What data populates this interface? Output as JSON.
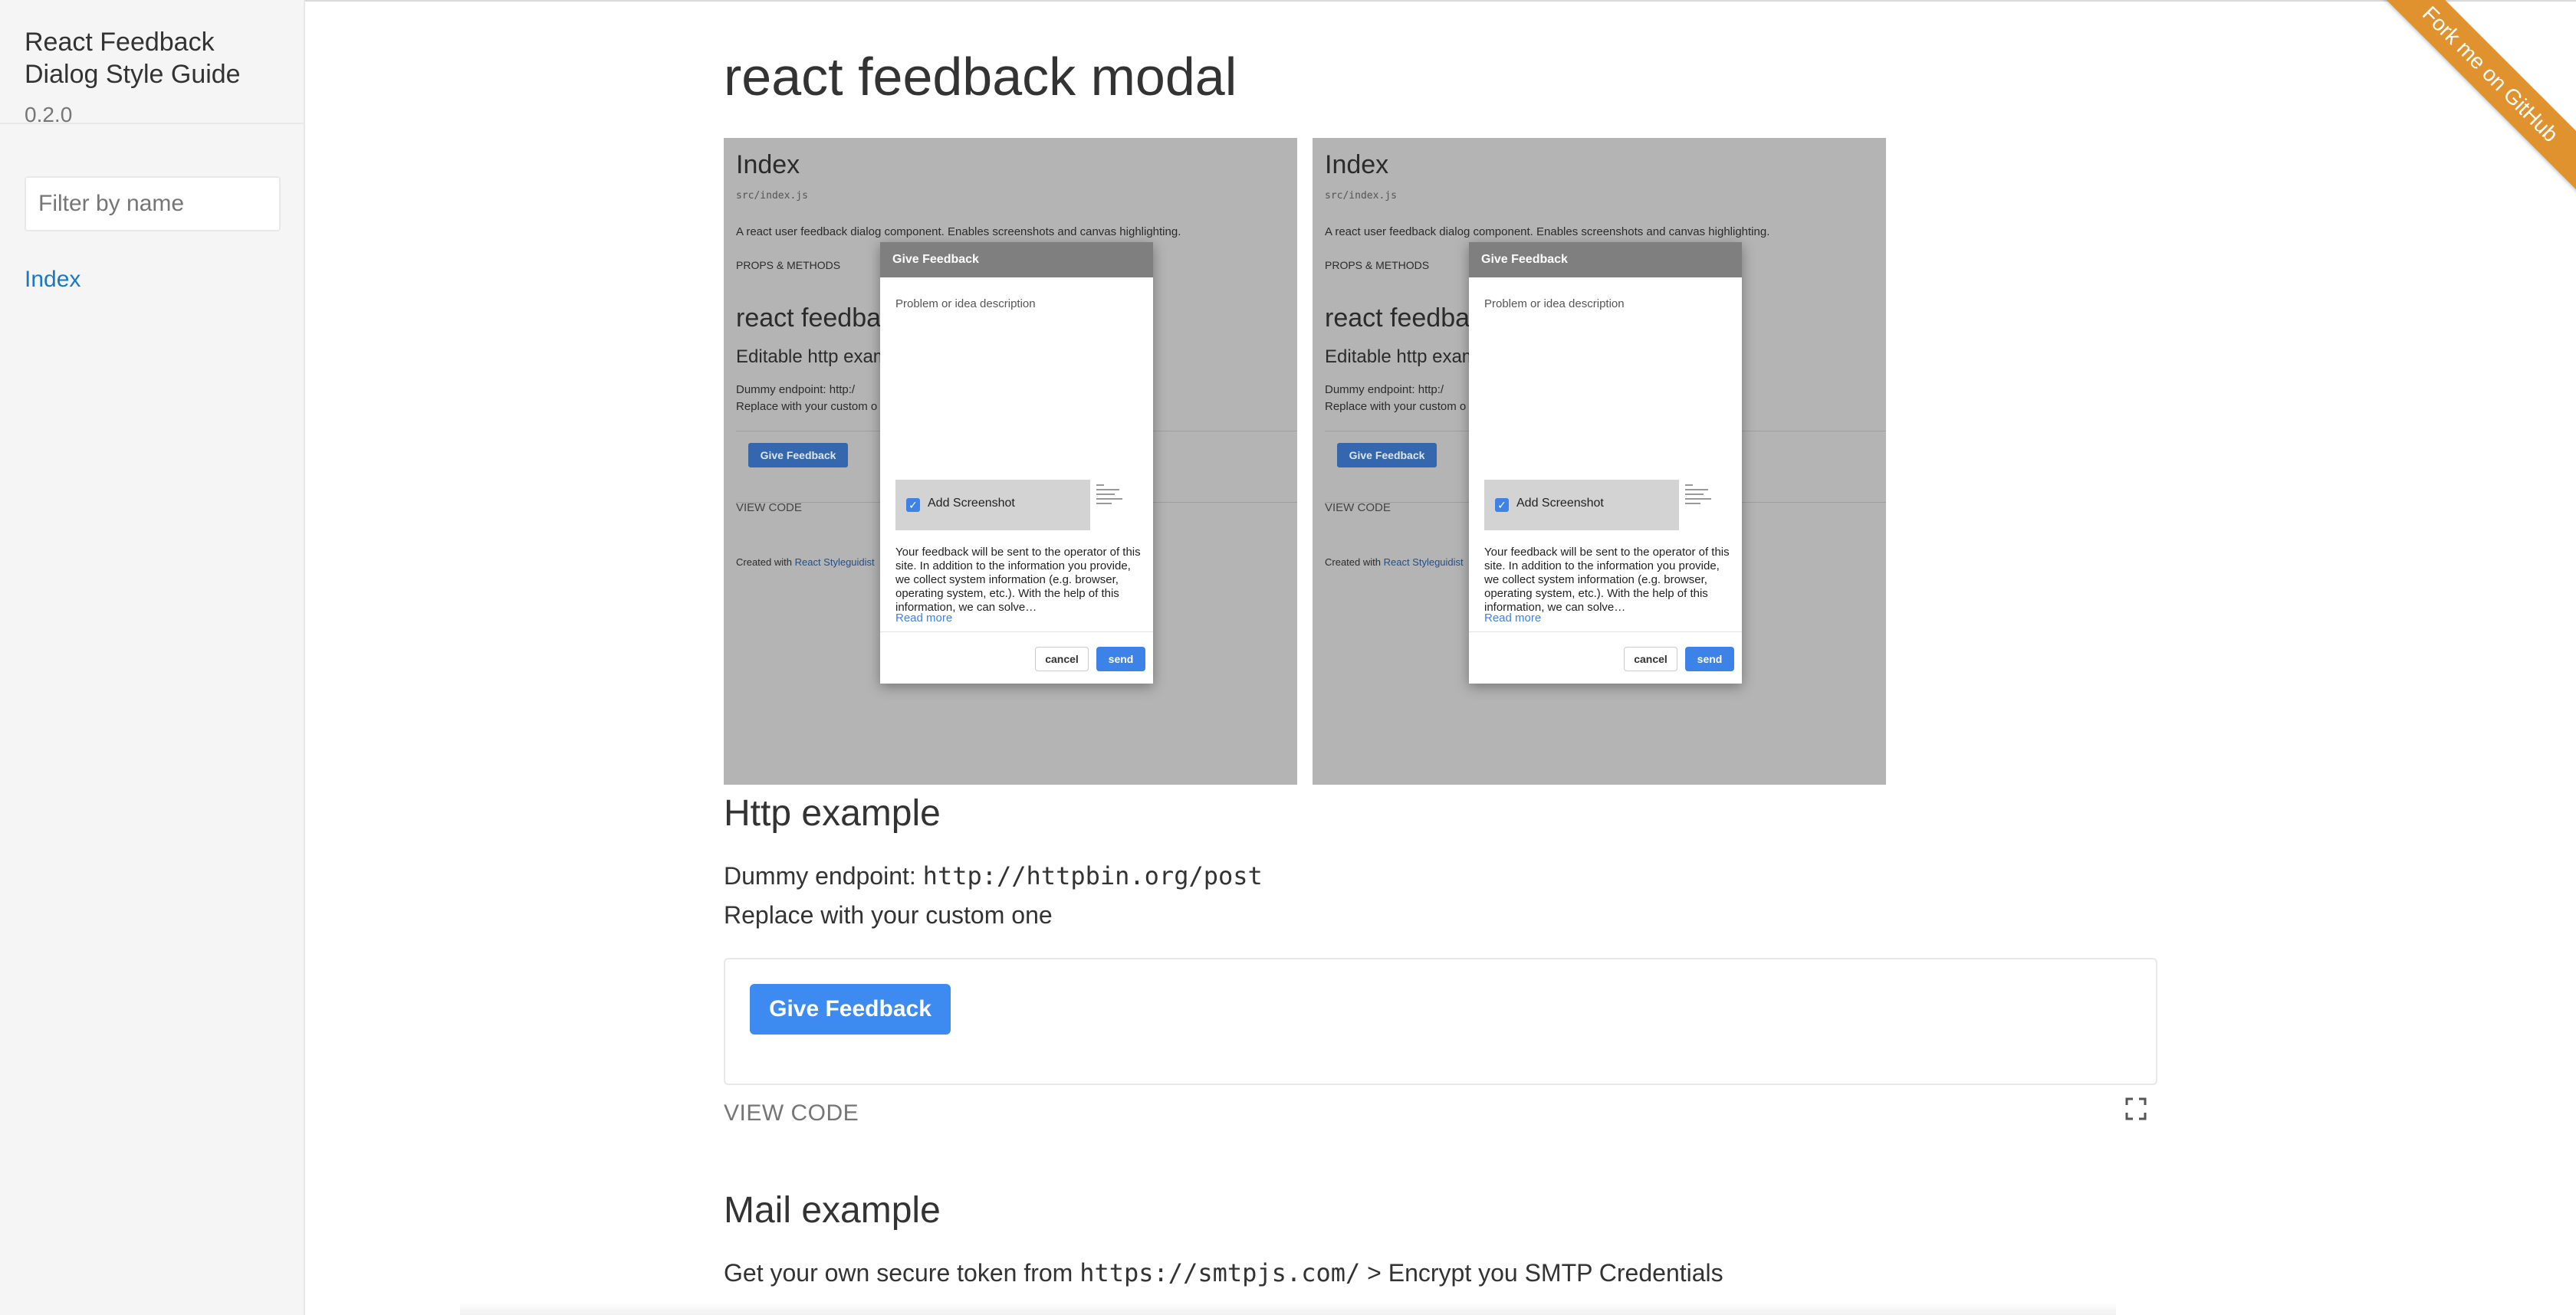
{
  "sidebar": {
    "title": "React Feedback Dialog Style Guide",
    "version": "0.2.0",
    "filter_placeholder": "Filter by name",
    "nav_items": [
      {
        "label": "Index"
      }
    ]
  },
  "ribbon": {
    "label": "Fork me on GitHub"
  },
  "main": {
    "title": "react feedback modal",
    "screenshots": [
      {
        "page_title": "Index",
        "path": "src/index.js",
        "description": "A react user feedback dialog component. Enables screenshots and canvas highlighting.",
        "props_label": "PROPS & METHODS",
        "heading": "react feedba",
        "subheading": "Editable http exam",
        "endpoint_line": "Dummy endpoint: http:/",
        "replace_line": "Replace with your custom o",
        "button_label": "Give Feedback",
        "view_code": "VIEW CODE",
        "created_prefix": "Created with",
        "created_link": "React Styleguidist",
        "modal": {
          "title": "Give Feedback",
          "placeholder": "Problem or idea description",
          "checkbox_label": "Add Screenshot",
          "info": "Your feedback will be sent to the operator of this site. In addition to the information you provide, we collect system information (e.g. browser, operating system, etc.). With the help of this information, we can solve…",
          "read_more": "Read more",
          "cancel": "cancel",
          "send": "send"
        }
      },
      {
        "page_title": "Index",
        "path": "src/index.js",
        "description": "A react user feedback dialog component. Enables screenshots and canvas highlighting.",
        "props_label": "PROPS & METHODS",
        "heading": "react feedba",
        "subheading": "Editable http exam",
        "endpoint_line": "Dummy endpoint: http:/",
        "replace_line": "Replace with your custom o",
        "button_label": "Give Feedback",
        "view_code": "VIEW CODE",
        "created_prefix": "Created with",
        "created_link": "React Styleguidist",
        "modal": {
          "title": "Give Feedback",
          "placeholder": "Problem or idea description",
          "checkbox_label": "Add Screenshot",
          "info": "Your feedback will be sent to the operator of this site. In addition to the information you provide, we collect system information (e.g. browser, operating system, etc.). With the help of this information, we can solve…",
          "read_more": "Read more",
          "cancel": "cancel",
          "send": "send"
        }
      }
    ],
    "http": {
      "heading": "Http example",
      "endpoint_prefix": "Dummy endpoint:",
      "endpoint_url": "http://httpbin.org/post",
      "replace_text": "Replace with your custom one",
      "button_label": "Give Feedback",
      "view_code": "VIEW CODE"
    },
    "mail": {
      "heading": "Mail example",
      "text_prefix": "Get your own secure token from",
      "url": "https://smtpjs.com/",
      "text_suffix": "> Encrypt you SMTP Credentials"
    }
  },
  "colors": {
    "accent": "#3d8bf0",
    "link": "#1978c8",
    "ribbon": "#e0922f",
    "sidebar_bg": "#f5f5f5"
  },
  "icons": {
    "fullscreen": "fullscreen-icon",
    "checkbox": "checkbox-checked-icon"
  }
}
